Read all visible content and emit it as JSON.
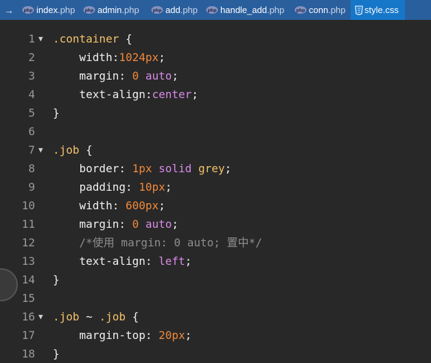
{
  "tabbar": {
    "arrow": "→",
    "tabs": [
      {
        "name": "index",
        "ext": ".php",
        "icon": "php-icon",
        "active": false
      },
      {
        "name": "admin",
        "ext": ".php",
        "icon": "php-icon",
        "active": false
      },
      {
        "name": "add",
        "ext": ".php",
        "icon": "php-icon",
        "active": false
      },
      {
        "name": "handle_add",
        "ext": ".php",
        "icon": "php-icon",
        "active": false
      },
      {
        "name": "conn",
        "ext": ".php",
        "icon": "php-icon",
        "active": false
      },
      {
        "name": "style.css",
        "ext": "",
        "icon": "css-icon",
        "active": true
      }
    ]
  },
  "editor": {
    "lines": [
      {
        "n": "1",
        "fold": true,
        "tokens": [
          [
            "sel",
            ".container"
          ],
          [
            "punc",
            " {"
          ]
        ]
      },
      {
        "n": "2",
        "fold": false,
        "tokens": [
          [
            "prop",
            "    width:"
          ],
          [
            "num",
            "1024px"
          ],
          [
            "punc",
            ";"
          ]
        ]
      },
      {
        "n": "3",
        "fold": false,
        "tokens": [
          [
            "prop",
            "    margin: "
          ],
          [
            "num",
            "0"
          ],
          [
            "punc",
            " "
          ],
          [
            "kw",
            "auto"
          ],
          [
            "punc",
            ";"
          ]
        ]
      },
      {
        "n": "4",
        "fold": false,
        "tokens": [
          [
            "prop",
            "    text-align:"
          ],
          [
            "kw",
            "center"
          ],
          [
            "punc",
            ";"
          ]
        ]
      },
      {
        "n": "5",
        "fold": false,
        "tokens": [
          [
            "punc",
            "}"
          ]
        ]
      },
      {
        "n": "6",
        "fold": false,
        "tokens": []
      },
      {
        "n": "7",
        "fold": true,
        "tokens": [
          [
            "sel",
            ".job"
          ],
          [
            "punc",
            " {"
          ]
        ]
      },
      {
        "n": "8",
        "fold": false,
        "tokens": [
          [
            "prop",
            "    border: "
          ],
          [
            "num",
            "1px"
          ],
          [
            "punc",
            " "
          ],
          [
            "kw",
            "solid"
          ],
          [
            "punc",
            " "
          ],
          [
            "sel",
            "grey"
          ],
          [
            "punc",
            ";"
          ]
        ]
      },
      {
        "n": "9",
        "fold": false,
        "tokens": [
          [
            "prop",
            "    padding: "
          ],
          [
            "num",
            "10px"
          ],
          [
            "punc",
            ";"
          ]
        ]
      },
      {
        "n": "10",
        "fold": false,
        "tokens": [
          [
            "prop",
            "    width: "
          ],
          [
            "num",
            "600px"
          ],
          [
            "punc",
            ";"
          ]
        ]
      },
      {
        "n": "11",
        "fold": false,
        "tokens": [
          [
            "prop",
            "    margin: "
          ],
          [
            "num",
            "0"
          ],
          [
            "punc",
            " "
          ],
          [
            "kw",
            "auto"
          ],
          [
            "punc",
            ";"
          ]
        ]
      },
      {
        "n": "12",
        "fold": false,
        "tokens": [
          [
            "comment",
            "    /*使用 margin: 0 auto; 置中*/"
          ]
        ]
      },
      {
        "n": "13",
        "fold": false,
        "tokens": [
          [
            "prop",
            "    text-align: "
          ],
          [
            "kw",
            "left"
          ],
          [
            "punc",
            ";"
          ]
        ]
      },
      {
        "n": "14",
        "fold": false,
        "tokens": [
          [
            "punc",
            "}"
          ]
        ]
      },
      {
        "n": "15",
        "fold": false,
        "tokens": []
      },
      {
        "n": "16",
        "fold": true,
        "tokens": [
          [
            "sel",
            ".job"
          ],
          [
            "punc",
            " ~ "
          ],
          [
            "sel",
            ".job"
          ],
          [
            "punc",
            " {"
          ]
        ]
      },
      {
        "n": "17",
        "fold": false,
        "tokens": [
          [
            "prop",
            "    margin-top: "
          ],
          [
            "num",
            "20px"
          ],
          [
            "punc",
            ";"
          ]
        ]
      },
      {
        "n": "18",
        "fold": false,
        "tokens": [
          [
            "punc",
            "}"
          ]
        ]
      }
    ]
  },
  "colors": {
    "tabbar_bg": "#2a5f9e",
    "active_tab_bg": "#1677c9",
    "editor_bg": "#282828",
    "selector": "#f5c46b",
    "number": "#f08a3c",
    "keyword": "#d88be8",
    "comment": "#8e8e8e"
  }
}
